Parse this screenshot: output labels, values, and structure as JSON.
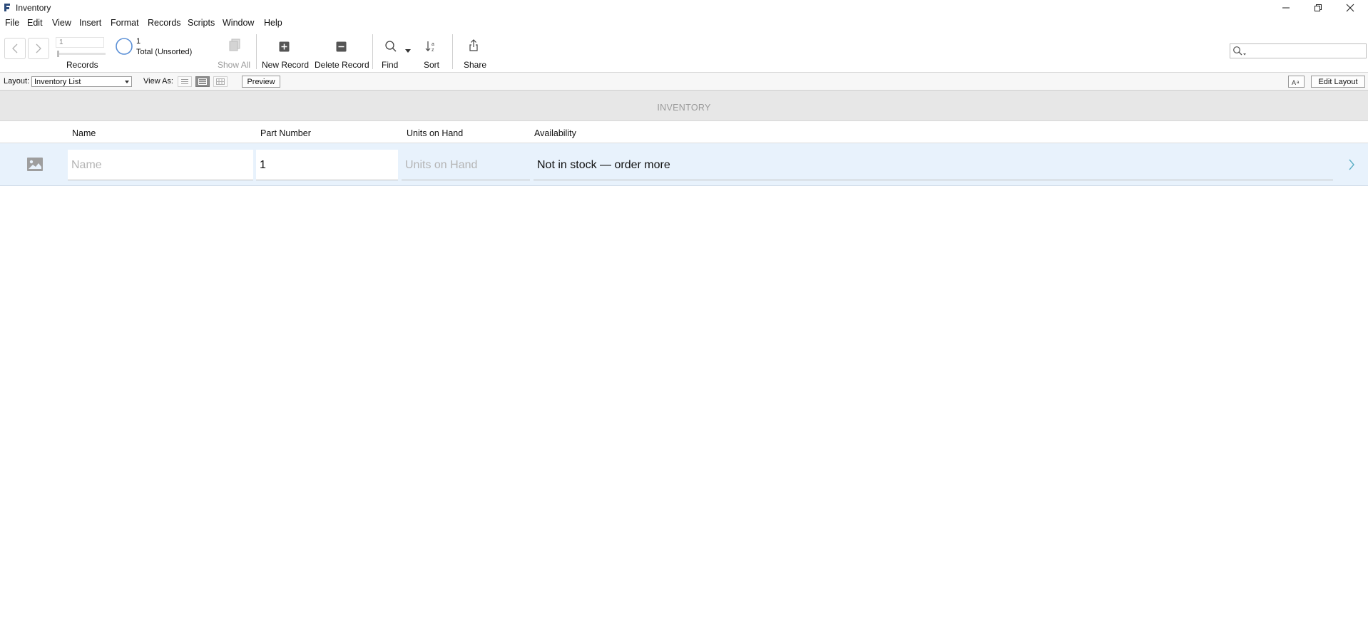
{
  "window": {
    "title": "Inventory"
  },
  "menu": [
    "File",
    "Edit",
    "View",
    "Insert",
    "Format",
    "Records",
    "Scripts",
    "Window",
    "Help"
  ],
  "toolbar": {
    "record_number": "1",
    "records_label": "Records",
    "total_count": "1",
    "total_label": "Total (Unsorted)",
    "show_all": "Show All",
    "new_record": "New Record",
    "delete_record": "Delete Record",
    "find": "Find",
    "sort": "Sort",
    "share": "Share"
  },
  "layoutbar": {
    "layout_label": "Layout:",
    "layout_value": "Inventory List",
    "view_as_label": "View As:",
    "preview": "Preview",
    "edit_layout": "Edit Layout"
  },
  "header": {
    "title": "INVENTORY"
  },
  "columns": [
    "Name",
    "Part Number",
    "Units on Hand",
    "Availability"
  ],
  "record": {
    "name_placeholder": "Name",
    "part_number": "1",
    "units_placeholder": "Units on Hand",
    "availability": "Not in stock — order more"
  },
  "colors": {
    "row_highlight": "#e8f2fc",
    "header_band": "#e7e7e7",
    "accent_blue": "#5a8fd6",
    "arrow_teal": "#5aaec4"
  }
}
